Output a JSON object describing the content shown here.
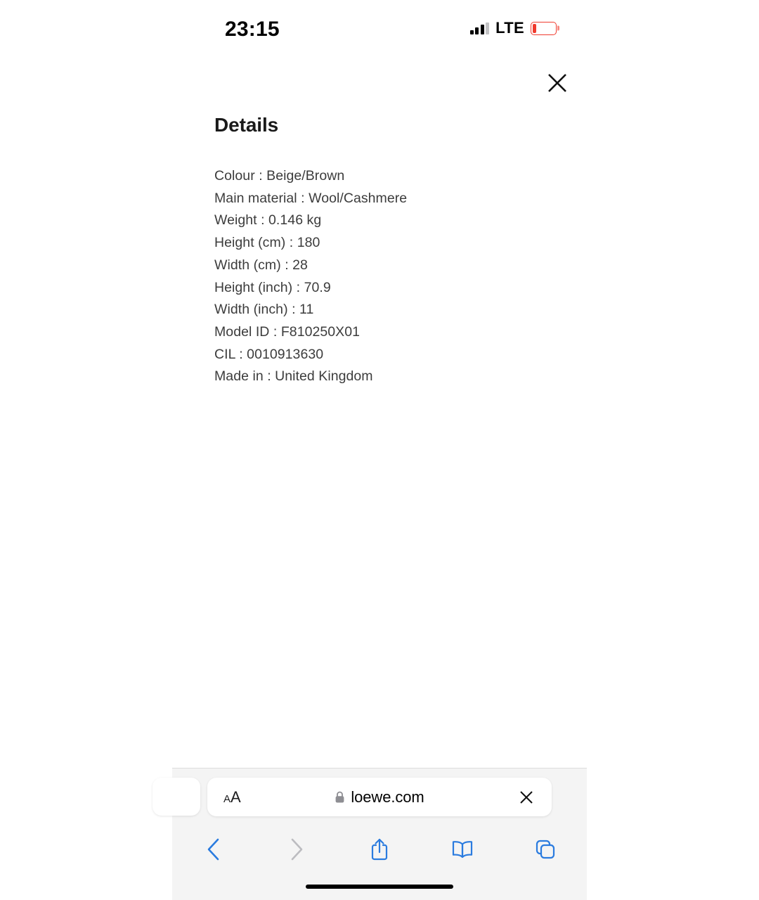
{
  "status_bar": {
    "time": "23:15",
    "network_label": "LTE",
    "signal_bars_filled": 3,
    "signal_bars_total": 4,
    "battery_level_percent": 16,
    "battery_color": "#f03b2e",
    "signal_icon": "cellular-signal-icon",
    "battery_icon": "battery-low-icon"
  },
  "page": {
    "close_icon": "close-icon",
    "title": "Details",
    "details": [
      "Colour : Beige/Brown",
      "Main material : Wool/Cashmere",
      "Weight : 0.146 kg",
      "Height (cm) : 180",
      "Width (cm) : 28",
      "Height (inch) : 70.9",
      "Width (inch) : 11",
      "Model ID : F810250X01",
      "CIL : 0010913630",
      "Made in : United Kingdom"
    ]
  },
  "browser": {
    "text_size_label_small": "A",
    "text_size_label_large": "A",
    "text_size_icon": "text-size-aa-icon",
    "lock_icon": "lock-icon",
    "url": "loewe.com",
    "url_placeholder": "Search or enter website name",
    "stop_icon": "close-icon",
    "accent_color": "#2a7bdf",
    "toolbar": [
      {
        "name": "back-button",
        "icon": "chevron-left-icon",
        "enabled": true
      },
      {
        "name": "forward-button",
        "icon": "chevron-right-icon",
        "enabled": false
      },
      {
        "name": "share-button",
        "icon": "share-icon",
        "enabled": true
      },
      {
        "name": "bookmarks-button",
        "icon": "book-icon",
        "enabled": true
      },
      {
        "name": "tabs-button",
        "icon": "tabs-icon",
        "enabled": true
      }
    ]
  }
}
